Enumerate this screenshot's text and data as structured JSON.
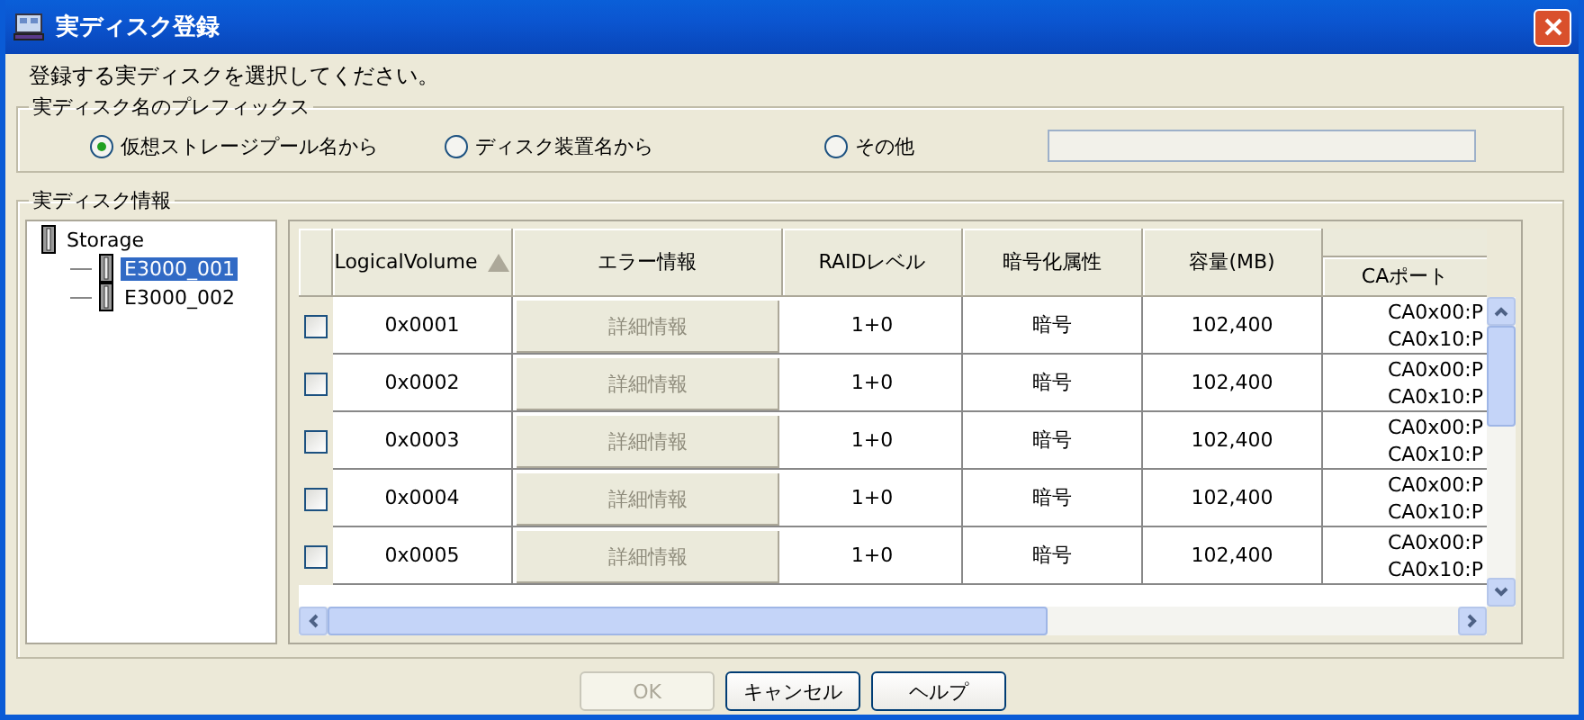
{
  "window": {
    "title": "実ディスク登録"
  },
  "instruction": "登録する実ディスクを選択してください。",
  "prefix_group": {
    "title": "実ディスク名のプレフィックス",
    "options": [
      {
        "label": "仮想ストレージプール名から",
        "selected": true
      },
      {
        "label": "ディスク装置名から",
        "selected": false
      },
      {
        "label": "その他",
        "selected": false
      }
    ]
  },
  "info_group": {
    "title": "実ディスク情報",
    "tree": [
      {
        "label": "Storage",
        "selected": false,
        "expanded": true,
        "children": [
          {
            "label": "E3000_001",
            "selected": true
          },
          {
            "label": "E3000_002",
            "selected": false
          }
        ]
      }
    ],
    "table": {
      "columns": [
        {
          "label": "LogicalVolume",
          "kind": "plain",
          "sorted": true
        },
        {
          "label": "エラー情報",
          "kind": "plain"
        },
        {
          "label": "RAIDレベル",
          "kind": "plain"
        },
        {
          "label": "暗号化属性",
          "kind": "plain"
        },
        {
          "label": "容量(MB)",
          "kind": "plain"
        },
        {
          "label": "CAポート",
          "kind": "grouped"
        }
      ],
      "rows": [
        {
          "checked": false,
          "logical_volume": "0x0001",
          "error_info": {
            "label": "詳細情報",
            "disabled": true
          },
          "raid_level": "1+0",
          "encryption": "暗号",
          "capacity": "102,400",
          "ca_port": [
            "CA0x00:P",
            "CA0x10:P"
          ]
        },
        {
          "checked": false,
          "logical_volume": "0x0002",
          "error_info": {
            "label": "詳細情報",
            "disabled": true
          },
          "raid_level": "1+0",
          "encryption": "暗号",
          "capacity": "102,400",
          "ca_port": [
            "CA0x00:P",
            "CA0x10:P"
          ]
        },
        {
          "checked": false,
          "logical_volume": "0x0003",
          "error_info": {
            "label": "詳細情報",
            "disabled": true
          },
          "raid_level": "1+0",
          "encryption": "暗号",
          "capacity": "102,400",
          "ca_port": [
            "CA0x00:P",
            "CA0x10:P"
          ]
        },
        {
          "checked": false,
          "logical_volume": "0x0004",
          "error_info": {
            "label": "詳細情報",
            "disabled": true
          },
          "raid_level": "1+0",
          "encryption": "暗号",
          "capacity": "102,400",
          "ca_port": [
            "CA0x00:P",
            "CA0x10:P"
          ]
        },
        {
          "checked": false,
          "logical_volume": "0x0005",
          "error_info": {
            "label": "詳細情報",
            "disabled": true
          },
          "raid_level": "1+0",
          "encryption": "暗号",
          "capacity": "102,400",
          "ca_port": [
            "CA0x00:P",
            "CA0x10:P"
          ]
        }
      ]
    }
  },
  "buttons": [
    {
      "label": "OK",
      "disabled": true
    },
    {
      "label": "キャンセル",
      "disabled": false
    },
    {
      "label": "ヘルプ",
      "disabled": false
    }
  ]
}
